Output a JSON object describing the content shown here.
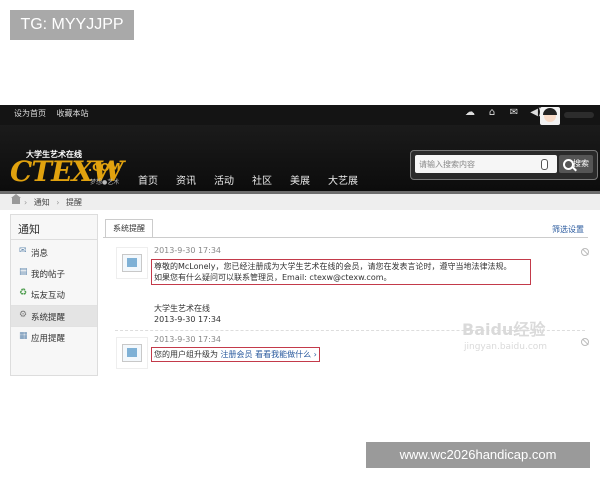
{
  "watermark_top": "TG: MYYJJPP",
  "watermark_bottom": "www.wc2026handicap.com",
  "watermark_baidu": {
    "brand": "Baidu经验",
    "url": "jingyan.baidu.com"
  },
  "topbar": {
    "links": [
      "设为首页",
      "收藏本站"
    ],
    "icons": [
      "cloud-icon",
      "home-icon",
      "mail-icon",
      "sound-icon"
    ]
  },
  "header": {
    "logo": {
      "main": "CTEXW",
      "dotcom": ".COM",
      "slogan": "大学生艺术在线",
      "tagline": "梦想●艺术"
    },
    "nav": [
      "首页",
      "资讯",
      "活动",
      "社区",
      "美展",
      "大艺展"
    ],
    "search": {
      "placeholder": "请输入搜索内容",
      "button": "搜索"
    }
  },
  "breadcrumb": [
    "通知",
    "提醒"
  ],
  "sidebar": {
    "title": "通知",
    "items": [
      {
        "label": "消息",
        "icon": "envelope-icon"
      },
      {
        "label": "我的帖子",
        "icon": "document-icon"
      },
      {
        "label": "坛友互动",
        "icon": "recycle-icon"
      },
      {
        "label": "系统提醒",
        "icon": "gear-icon"
      },
      {
        "label": "应用提醒",
        "icon": "grid-icon"
      }
    ]
  },
  "main": {
    "tab": "系统提醒",
    "filter": "筛选设置",
    "notices": [
      {
        "time": "2013-9-30 17:34",
        "line1": "尊敬的McLonely，您已经注册成为大学生艺术在线的会员，请您在发表言论时，遵守当地法律法规。",
        "line2": "如果您有什么疑问可以联系管理员，Email: ctexw@ctexw.com。"
      },
      {
        "sender": "大学生艺术在线",
        "time": "2013-9-30 17:34"
      },
      {
        "time": "2013-9-30 17:34",
        "text_prefix": "您的用户组升级为",
        "link1": "注册会员",
        "link2": "看看我能做什么 ›"
      }
    ]
  }
}
